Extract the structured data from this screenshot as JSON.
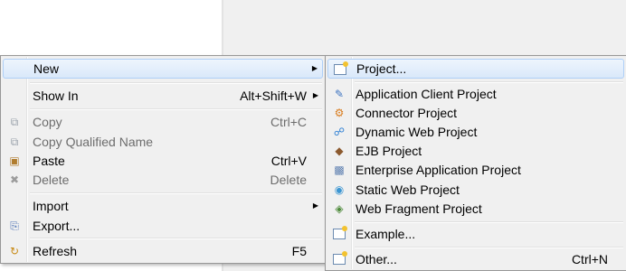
{
  "context_menu": {
    "items": [
      {
        "label": "New",
        "shortcut": ""
      },
      {
        "label": "Show In",
        "shortcut": "Alt+Shift+W"
      },
      {
        "label": "Copy",
        "shortcut": "Ctrl+C"
      },
      {
        "label": "Copy Qualified Name",
        "shortcut": ""
      },
      {
        "label": "Paste",
        "shortcut": "Ctrl+V"
      },
      {
        "label": "Delete",
        "shortcut": "Delete"
      },
      {
        "label": "Import",
        "shortcut": ""
      },
      {
        "label": "Export...",
        "shortcut": ""
      },
      {
        "label": "Refresh",
        "shortcut": "F5"
      }
    ]
  },
  "submenu": {
    "items": [
      {
        "label": "Project...",
        "icon": "project-icon"
      },
      {
        "label": "Application Client Project",
        "icon": "application-client-project-icon"
      },
      {
        "label": "Connector Project",
        "icon": "connector-project-icon"
      },
      {
        "label": "Dynamic Web Project",
        "icon": "dynamic-web-project-icon"
      },
      {
        "label": "EJB Project",
        "icon": "ejb-project-icon"
      },
      {
        "label": "Enterprise Application Project",
        "icon": "enterprise-application-project-icon"
      },
      {
        "label": "Static Web Project",
        "icon": "static-web-project-icon"
      },
      {
        "label": "Web Fragment Project",
        "icon": "web-fragment-project-icon"
      },
      {
        "label": "Example...",
        "icon": "example-icon"
      },
      {
        "label": "Other...",
        "shortcut": "Ctrl+N",
        "icon": "other-wizard-icon"
      }
    ]
  },
  "colors": {
    "highlight": "#d9e8fa",
    "highlight_border": "#aecff7",
    "disabled_text": "#6d6d6d",
    "menu_bg": "#f0f0f0"
  }
}
